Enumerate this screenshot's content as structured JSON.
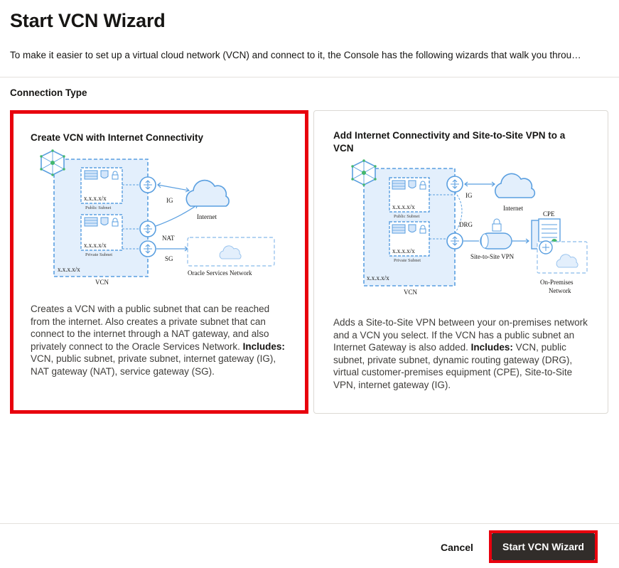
{
  "header": {
    "title": "Start VCN Wizard",
    "intro": "To make it easier to set up a virtual cloud network (VCN) and connect to it, the Console has the following wizards that walk you throu…"
  },
  "connection_type": {
    "label": "Connection Type",
    "cards": [
      {
        "title": "Create VCN with Internet Connectivity",
        "description": "Creates a VCN with a public subnet that can be reached from the internet. Also creates a private subnet that can connect to the internet through a NAT gateway, and also privately connect to the Oracle Services Network.",
        "includes_label": "Includes:",
        "includes": " VCN, public subnet, private subnet, internet gateway (IG), NAT gateway (NAT), service gateway (SG).",
        "selected": true,
        "diagram": {
          "subnet_cidr": "x.x.x.x/x",
          "public_subnet": "Public Subnet",
          "private_subnet": "Private Subnet",
          "vcn_cidr": "x.x.x.x/x",
          "vcn": "VCN",
          "ig": "IG",
          "nat": "NAT",
          "sg": "SG",
          "internet": "Internet",
          "oracle_services": "Oracle Services Network"
        }
      },
      {
        "title": "Add Internet Connectivity and Site-to-Site VPN to a VCN",
        "description": "Adds a Site-to-Site VPN between your on-premises network and a VCN you select. If the VCN has a public subnet an Internet Gateway is also added.",
        "includes_label": "Includes:",
        "includes": " VCN, public subnet, private subnet, dynamic routing gateway (DRG), virtual customer-premises equipment (CPE), Site-to-Site VPN, internet gateway (IG).",
        "selected": false,
        "diagram": {
          "subnet_cidr": "x.x.x.x/x",
          "public_subnet": "Public Subnet",
          "private_subnet": "Private Subnet",
          "vcn_cidr": "x.x.x.x/x",
          "vcn": "VCN",
          "ig": "IG",
          "drg": "DRG",
          "internet": "Internet",
          "cpe": "CPE",
          "vpn": "Site-to-Site VPN",
          "on_prem_1": "On-Premises",
          "on_prem_2": "Network"
        }
      }
    ]
  },
  "footer": {
    "cancel_label": "Cancel",
    "start_label": "Start VCN Wizard"
  },
  "colors": {
    "selection_outline": "#e8000d",
    "primary_button": "#312d2a",
    "diagram_blue": "#5a9fe0",
    "diagram_fill": "#e3effc"
  }
}
